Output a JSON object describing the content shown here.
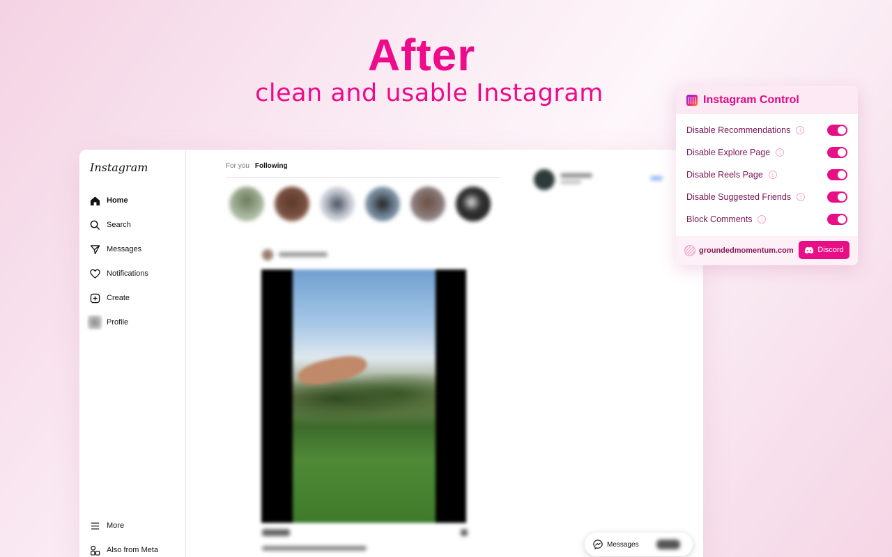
{
  "hero": {
    "title": "After",
    "subtitle": "clean and usable Instagram"
  },
  "instagram": {
    "logo": "Instagram",
    "nav": [
      {
        "label": "Home",
        "icon": "home-icon"
      },
      {
        "label": "Search",
        "icon": "search-icon"
      },
      {
        "label": "Messages",
        "icon": "send-icon"
      },
      {
        "label": "Notifications",
        "icon": "heart-icon"
      },
      {
        "label": "Create",
        "icon": "plus-square-icon"
      },
      {
        "label": "Profile",
        "icon": "avatar"
      }
    ],
    "nav_bottom": [
      {
        "label": "More",
        "icon": "menu-icon"
      },
      {
        "label": "Also from Meta",
        "icon": "meta-apps-icon"
      }
    ],
    "tabs": [
      {
        "label": "For you",
        "active": false
      },
      {
        "label": "Following",
        "active": true
      }
    ],
    "messages_pill": "Messages"
  },
  "extension": {
    "title": "Instagram Control",
    "options": [
      {
        "label": "Disable Recommendations",
        "enabled": true
      },
      {
        "label": "Disable Explore Page",
        "enabled": true
      },
      {
        "label": "Disable Reels Page",
        "enabled": true
      },
      {
        "label": "Disable Suggested Friends",
        "enabled": true
      },
      {
        "label": "Block Comments",
        "enabled": true
      }
    ],
    "site_link": "groundedmomentum.com",
    "discord_label": "Discord",
    "accent_color": "#e80f86"
  }
}
